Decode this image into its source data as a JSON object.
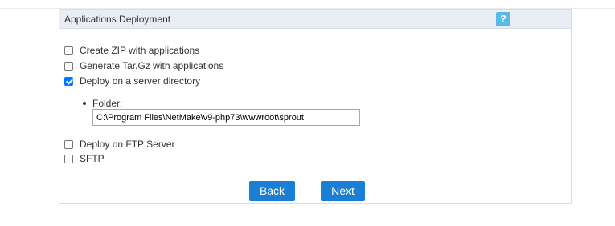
{
  "panel": {
    "title": "Applications Deployment",
    "help_label": "?"
  },
  "options": [
    {
      "label": "Create ZIP with applications",
      "checked": false
    },
    {
      "label": "Generate Tar.Gz with applications",
      "checked": false
    },
    {
      "label": "Deploy on a server directory",
      "checked": true
    },
    {
      "label": "Deploy on FTP Server",
      "checked": false
    },
    {
      "label": "SFTP",
      "checked": false
    }
  ],
  "folder": {
    "label": "Folder:",
    "value": "C:\\Program Files\\NetMake\\v9-php73\\wwwroot\\sprout"
  },
  "buttons": {
    "back_label": "Back",
    "next_label": "Next"
  },
  "colors": {
    "header_bg": "#e9eef4",
    "help_icon": "#5bb9e5",
    "button_bg": "#1a7fd4",
    "checkbox_checked": "#0075ff"
  }
}
